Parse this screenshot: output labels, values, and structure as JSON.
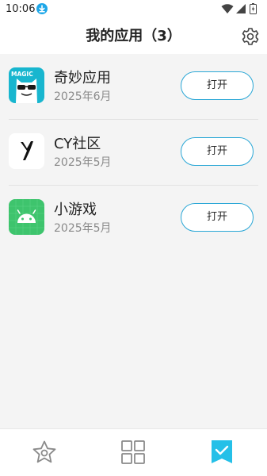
{
  "status_bar": {
    "time": "10:06",
    "icons": [
      "download-icon",
      "wifi-icon",
      "cellular-signal-icon",
      "battery-icon"
    ]
  },
  "header": {
    "title": "我的应用（3）",
    "settings_icon": "gear-icon"
  },
  "apps": [
    {
      "name": "奇妙应用",
      "date": "2025年6月",
      "open_label": "打开",
      "icon": "magic-app-icon",
      "icon_text": "MAGIC"
    },
    {
      "name": "CY社区",
      "date": "2025年5月",
      "open_label": "打开",
      "icon": "cy-community-icon"
    },
    {
      "name": "小游戏",
      "date": "2025年5月",
      "open_label": "打开",
      "icon": "android-icon"
    }
  ],
  "bottom_nav": {
    "items": [
      {
        "icon": "star-icon",
        "active": false
      },
      {
        "icon": "grid-icon",
        "active": false
      },
      {
        "icon": "check-bookmark-icon",
        "active": true
      }
    ]
  },
  "colors": {
    "accent": "#2aa7d6",
    "active_tab": "#25c0e8",
    "inactive_tab": "#8a8a8a",
    "background": "#f4f4f4"
  }
}
